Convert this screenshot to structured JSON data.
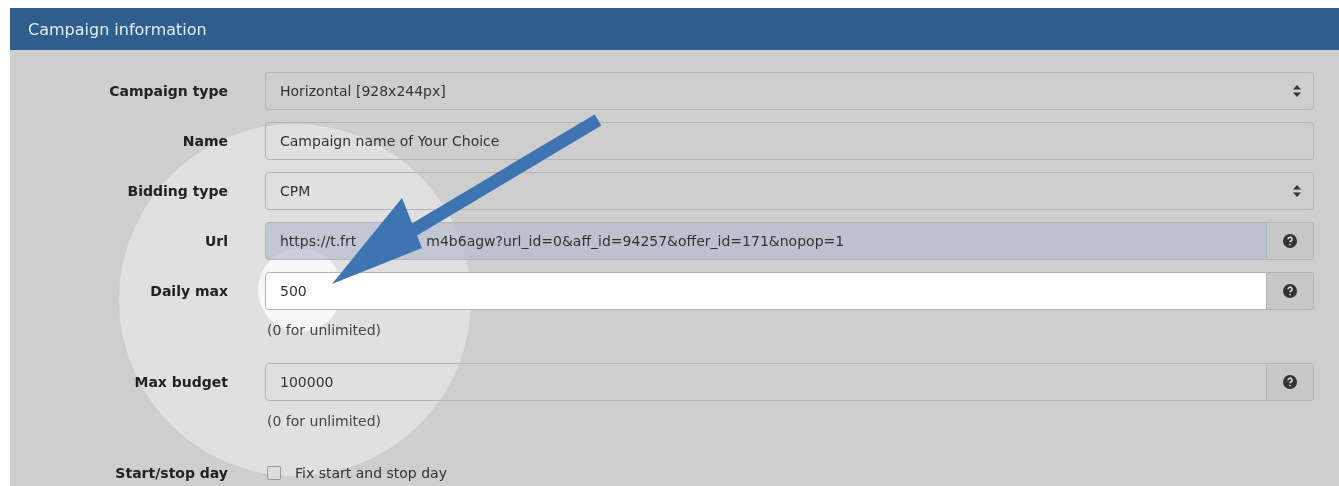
{
  "panel": {
    "title": "Campaign information"
  },
  "fields": [
    {
      "kind": "select",
      "label": "Campaign type",
      "value": "Horizontal [928x244px]"
    },
    {
      "kind": "text",
      "label": "Name",
      "value": "Campaign name of Your Choice"
    },
    {
      "kind": "select",
      "label": "Bidding type",
      "value": "CPM"
    },
    {
      "kind": "text_help",
      "label": "Url",
      "value_parts": [
        "https://t.frt",
        "m4b6agw?url_id=0&aff_id=94257&offer_id=171&nopop=1"
      ],
      "focused": true
    },
    {
      "kind": "text_help",
      "label": "Daily max",
      "value": "500",
      "hint": "(0 for unlimited)",
      "spotlit": true
    },
    {
      "kind": "text_help",
      "label": "Max budget",
      "value": "100000",
      "hint": "(0 for unlimited)"
    },
    {
      "kind": "checkbox",
      "label": "Start/stop day",
      "option": "Fix start and stop day",
      "checked": false
    }
  ]
}
